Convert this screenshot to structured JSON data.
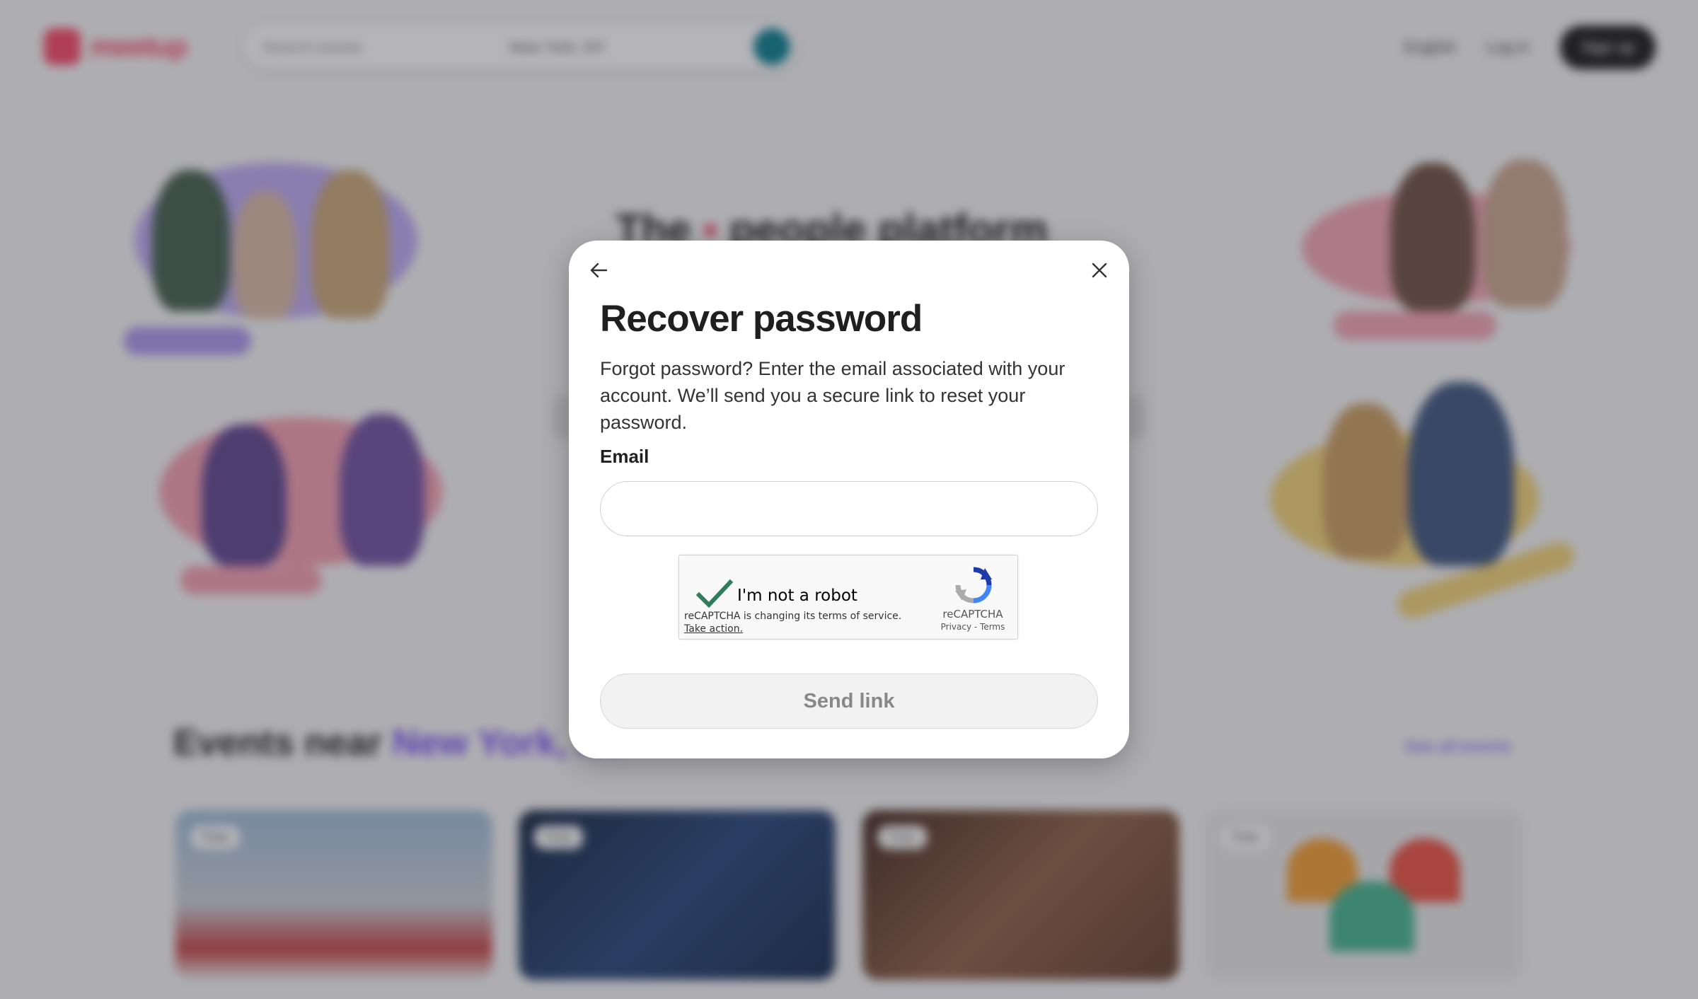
{
  "background": {
    "brand": "meetup",
    "search_placeholder": "Search events",
    "location": "New York, NY",
    "nav": {
      "language": "English",
      "login": "Log in",
      "signup": "Sign up"
    },
    "hero_title_start": "The",
    "hero_title_end": "people platform",
    "events_heading": "Events near",
    "events_location": "New York, NY",
    "see_all": "See all events",
    "card_badge": "Free",
    "colors": {
      "brand": "#f64060",
      "accent": "#6d45f0",
      "overlay": "rgba(60,60,70,0.38)"
    }
  },
  "modal": {
    "title": "Recover password",
    "description": "Forgot password? Enter the email associated with your account. We’ll send you a secure link to reset your password.",
    "email_label": "Email",
    "email_value": "",
    "submit_label": "Send link",
    "icons": {
      "back": "arrow-left-icon",
      "close": "close-icon"
    }
  },
  "recaptcha": {
    "label": "I'm not a robot",
    "notice": "reCAPTCHA is changing its terms of service.",
    "action": "Take action.",
    "brand": "reCAPTCHA",
    "links": "Privacy - Terms",
    "checked": true,
    "check_color": "#2f7d5b"
  }
}
